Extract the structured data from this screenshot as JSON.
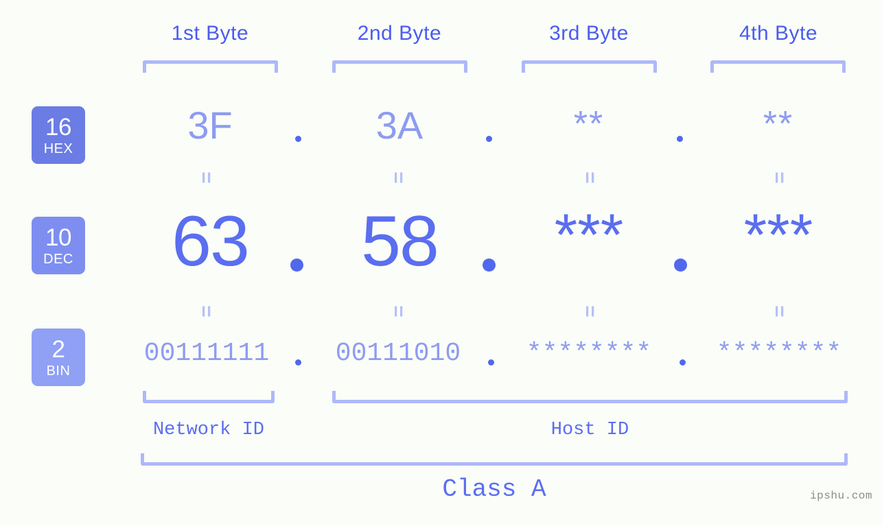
{
  "page": {
    "background_color": "#fbfdf8",
    "accent_dark": "#4a5cf0",
    "accent_mid": "#5a6ef0",
    "accent_light": "#8d9cf0",
    "bracket_color": "#aeb8f8",
    "watermark": "ipshu.com"
  },
  "byte_headers": [
    {
      "label": "1st Byte"
    },
    {
      "label": "2nd Byte"
    },
    {
      "label": "3rd Byte"
    },
    {
      "label": "4th Byte"
    }
  ],
  "rows": [
    {
      "badge": {
        "num": "16",
        "sub": "HEX",
        "color": "#6b7ce4"
      },
      "values": [
        "3F",
        "3A",
        "**",
        "**"
      ],
      "separator": "."
    },
    {
      "badge": {
        "num": "10",
        "sub": "DEC",
        "color": "#7e8ef0"
      },
      "values": [
        "63",
        "58",
        "***",
        "***"
      ],
      "separator": "."
    },
    {
      "badge": {
        "num": "2",
        "sub": "BIN",
        "color": "#8fa0f5"
      },
      "values": [
        "00111111",
        "00111010",
        "********",
        "********"
      ],
      "separator": "."
    }
  ],
  "equals_marks": {
    "symbol": "="
  },
  "sections": [
    {
      "label": "Network ID"
    },
    {
      "label": "Host ID"
    }
  ],
  "class": {
    "label": "Class A"
  }
}
